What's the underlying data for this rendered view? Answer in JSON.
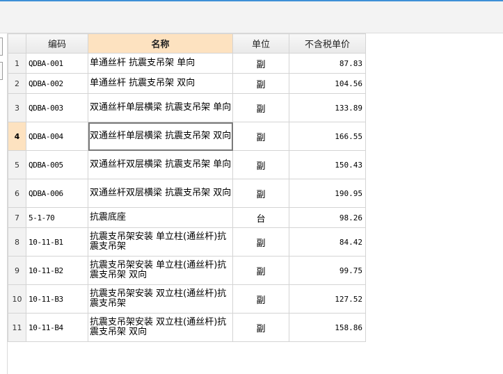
{
  "table": {
    "columns": [
      {
        "key": "row_no",
        "label": ""
      },
      {
        "key": "code",
        "label": "编码"
      },
      {
        "key": "name",
        "label": "名称"
      },
      {
        "key": "unit",
        "label": "单位"
      },
      {
        "key": "price",
        "label": "不含税单价"
      }
    ],
    "active_column": "name",
    "current_row": 4,
    "rows": [
      {
        "no": "1",
        "code": "QDBA-001",
        "name": "单通丝杆 抗震支吊架 单向",
        "unit": "副",
        "price": "87.83"
      },
      {
        "no": "2",
        "code": "QDBA-002",
        "name": "单通丝杆 抗震支吊架 双向",
        "unit": "副",
        "price": "104.56"
      },
      {
        "no": "3",
        "code": "QDBA-003",
        "name": "双通丝杆单层横梁 抗震支吊架 单向",
        "unit": "副",
        "price": "133.89"
      },
      {
        "no": "4",
        "code": "QDBA-004",
        "name": "双通丝杆单层横梁 抗震支吊架 双向",
        "unit": "副",
        "price": "166.55"
      },
      {
        "no": "5",
        "code": "QDBA-005",
        "name": "双通丝杆双层横梁 抗震支吊架 单向",
        "unit": "副",
        "price": "150.43"
      },
      {
        "no": "6",
        "code": "QDBA-006",
        "name": "双通丝杆双层横梁 抗震支吊架 双向",
        "unit": "副",
        "price": "190.95"
      },
      {
        "no": "7",
        "code": "5-1-70",
        "name": "抗震底座",
        "unit": "台",
        "price": "98.26"
      },
      {
        "no": "8",
        "code": "10-11-B1",
        "name": "抗震支吊架安装 单立柱(通丝杆)抗震支吊架",
        "unit": "副",
        "price": "84.42"
      },
      {
        "no": "9",
        "code": "10-11-B2",
        "name": "抗震支吊架安装 单立柱(通丝杆)抗震支吊架 双向",
        "unit": "副",
        "price": "99.75"
      },
      {
        "no": "10",
        "code": "10-11-B3",
        "name": "抗震支吊架安装 双立柱(通丝杆)抗震支吊架",
        "unit": "副",
        "price": "127.52"
      },
      {
        "no": "11",
        "code": "10-11-B4",
        "name": "抗震支吊架安装 双立柱(通丝杆)抗震支吊架 双向",
        "unit": "副",
        "price": "158.86"
      }
    ]
  }
}
